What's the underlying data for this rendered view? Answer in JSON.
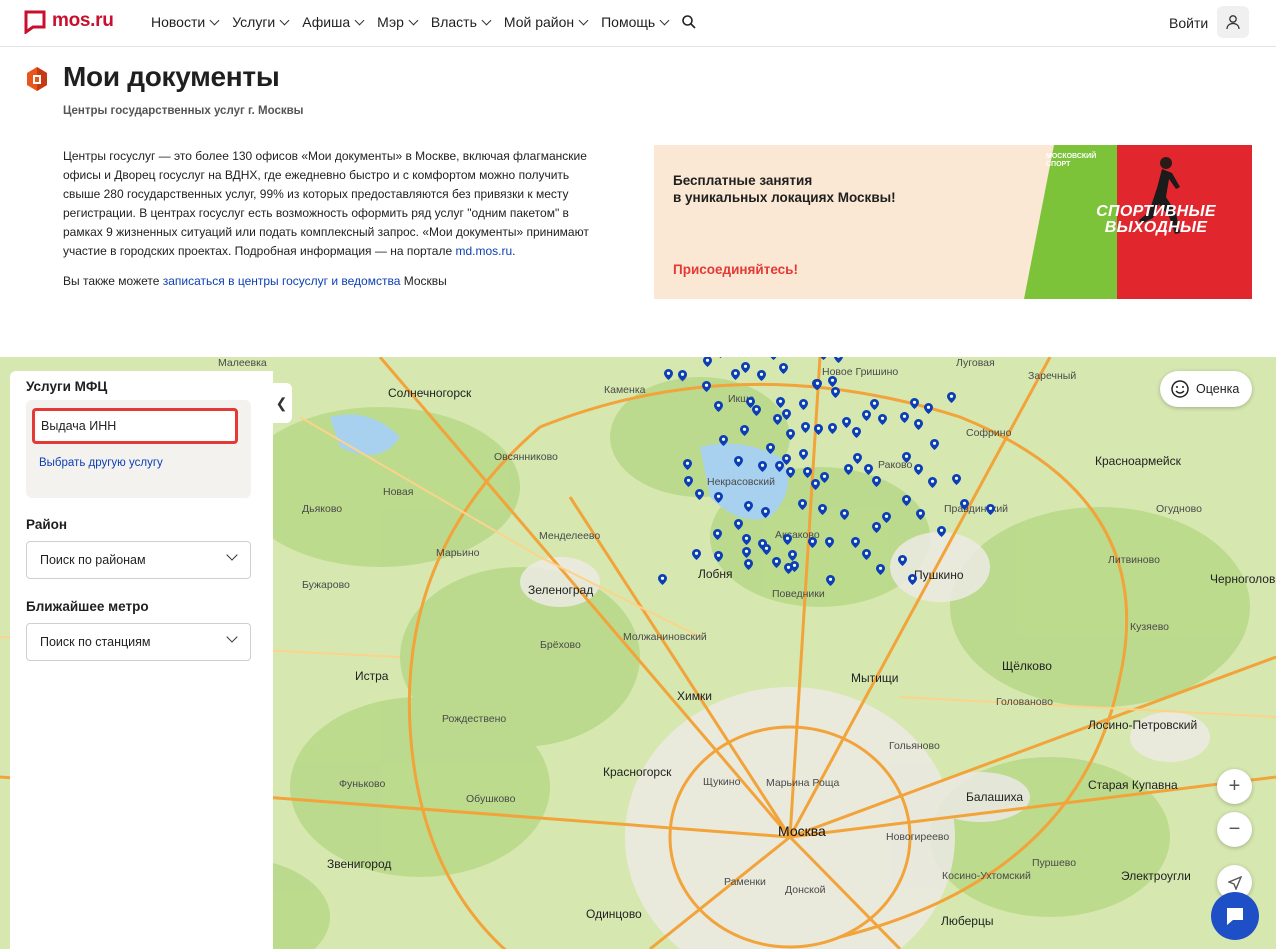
{
  "header": {
    "logo_text": "mos.ru",
    "nav": [
      "Новости",
      "Услуги",
      "Афиша",
      "Мэр",
      "Власть",
      "Мой район",
      "Помощь"
    ],
    "login": "Войти"
  },
  "page": {
    "title": "Мои документы",
    "subtitle": "Центры государственных услуг г. Москвы",
    "desc_text": "Центры госуслуг — это более 130 офисов «Мои документы» в Москве, включая флагманские офисы и Дворец госуслуг на ВДНХ, где ежедневно быстро и с комфортом можно получить свыше 280 государственных услуг, 99% из которых предоставляются без привязки к месту регистрации. В центрах госуслуг есть возможность оформить ряд услуг \"одним пакетом\" в рамках 9 жизненных ситуаций или подать комплексный запрос. «Мои документы» принимают участие в городских проектах. Подробная информация — на портале ",
    "desc_link": "md.mos.ru",
    "desc_end": ".",
    "also_prefix": "Вы также можете ",
    "also_link": "записаться в центры госуслуг и ведомства",
    "also_suffix": " Москвы"
  },
  "banner": {
    "title_line1": "Бесплатные занятия",
    "title_line2": "в уникальных локациях Москвы!",
    "cta": "Присоединяйтесь!",
    "sport_line1": "СПОРТИВНЫЕ",
    "sport_line2": "ВЫХОДНЫЕ",
    "brand": "МОСКОВСКИЙ СПОРТ"
  },
  "panel": {
    "services_heading": "Услуги МФЦ",
    "service_value": "Выдача ИНН",
    "change_service": "Выбрать другую услугу",
    "district_label": "Район",
    "district_placeholder": "Поиск по районам",
    "metro_label": "Ближайшее метро",
    "metro_placeholder": "Поиск по станциям"
  },
  "map": {
    "rate_label": "Оценка",
    "places": {
      "p1": "Малеевка",
      "p2": "Солнечногорск",
      "p3": "Каменка",
      "p4": "Икша",
      "p5": "Луговая",
      "p6": "Зеленоград",
      "p7": "Лобня",
      "p8": "Пушкино",
      "p9": "Мытищи",
      "p10": "Химки",
      "p11": "Щёлково",
      "p12": "Красногорск",
      "p13": "Москва",
      "p14": "Балашиха",
      "p15": "Одинцово",
      "p16": "Звенигород",
      "p17": "Люберцы",
      "p18": "Красноармейск",
      "p19": "Истра",
      "p20": "Лосино-Петровский",
      "p21": "Старая Купавна",
      "p22": "Электроугли",
      "p23": "Черноголовка",
      "p24": "Марьина Роща",
      "p25": "Софрино",
      "p26": "Новая",
      "p27": "Марьино",
      "p28": "Бужарово",
      "p29": "Дьяково",
      "p30": "Менделеево",
      "p31": "Некрасовский",
      "p32": "Аксаково",
      "p33": "Поведники",
      "p34": "Молжаниновский",
      "p35": "Брёхово",
      "p36": "Рождествено",
      "p37": "Фуньково",
      "p38": "Обушково",
      "p39": "Щукино",
      "p40": "Новогиреево",
      "p41": "Раменки",
      "p42": "Пуршево",
      "p43": "Правдинский",
      "p44": "Огудново",
      "p45": "Литвиново",
      "p46": "Заречный",
      "p47": "Раково",
      "p48": "Овсянниково",
      "p49": "Новое Гришино",
      "p50": "Кузяево",
      "p51": "Голованово",
      "p52": "Донской",
      "p53": "Гольяново",
      "p54": "Косино-Ухтомский"
    }
  }
}
